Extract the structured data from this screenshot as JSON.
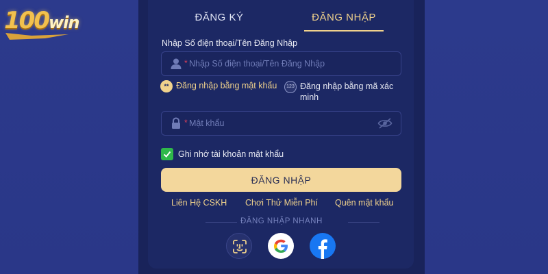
{
  "brand": {
    "logo_text": "100",
    "logo_text_win": "win"
  },
  "tabs": {
    "register": "ĐĂNG KÝ",
    "login": "ĐĂNG NHẬP"
  },
  "form": {
    "username_label": "Nhập Số điện thoại/Tên Đăng Nhập",
    "username_placeholder": "Nhập Số điện thoại/Tên Đăng Nhập",
    "required_mark": "*",
    "mode_password": "Đăng nhập bằng mật khẩu",
    "mode_password_icon_text": "**",
    "mode_code": "Đăng nhập bằng mã xác minh",
    "mode_code_icon_text": "123",
    "password_placeholder": "Mật khẩu",
    "remember_label": "Ghi nhớ tài khoản mật khẩu",
    "login_button": "ĐĂNG NHẬP"
  },
  "links": {
    "support": "Liên Hệ CSKH",
    "try_free": "Chơi Thử Miễn Phí",
    "forgot": "Quên mật khẩu"
  },
  "quick_login": {
    "title": "ĐĂNG NHẬP NHANH",
    "options": [
      "face-id-icon",
      "google-icon",
      "facebook-icon"
    ]
  },
  "colors": {
    "accent": "#f0d28c",
    "panel": "#1c2864",
    "button": "#f3d79c",
    "check": "#2fb84a"
  }
}
